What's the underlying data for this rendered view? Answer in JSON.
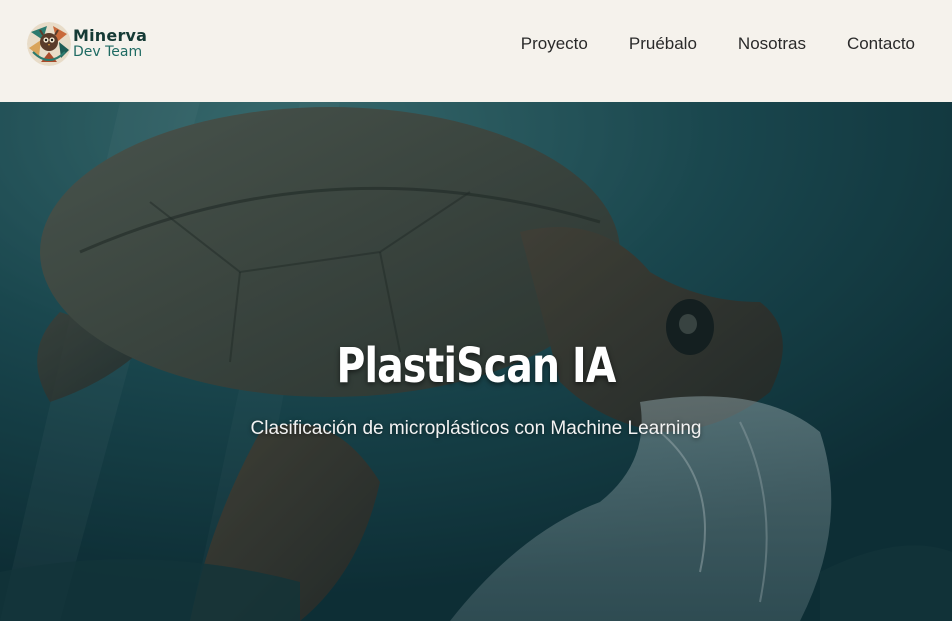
{
  "brand": {
    "name_line1": "Minerva",
    "name_line2": "Dev Team",
    "logo_icon": "minerva-owl-icon"
  },
  "nav": {
    "items": [
      {
        "label": "Proyecto"
      },
      {
        "label": "Pruébalo"
      },
      {
        "label": "Nosotras"
      },
      {
        "label": "Contacto"
      }
    ]
  },
  "hero": {
    "title": "PlastiScan IA",
    "subtitle": "Clasificación de microplásticos con Machine Learning",
    "background_image": "sea-turtle-with-plastic-bag"
  },
  "colors": {
    "header_bg": "#f5f2ec",
    "brand_dark": "#153a35",
    "brand_teal": "#1f6b63",
    "nav_text": "#2a2a2a",
    "hero_overlay": "#1d4d57"
  }
}
